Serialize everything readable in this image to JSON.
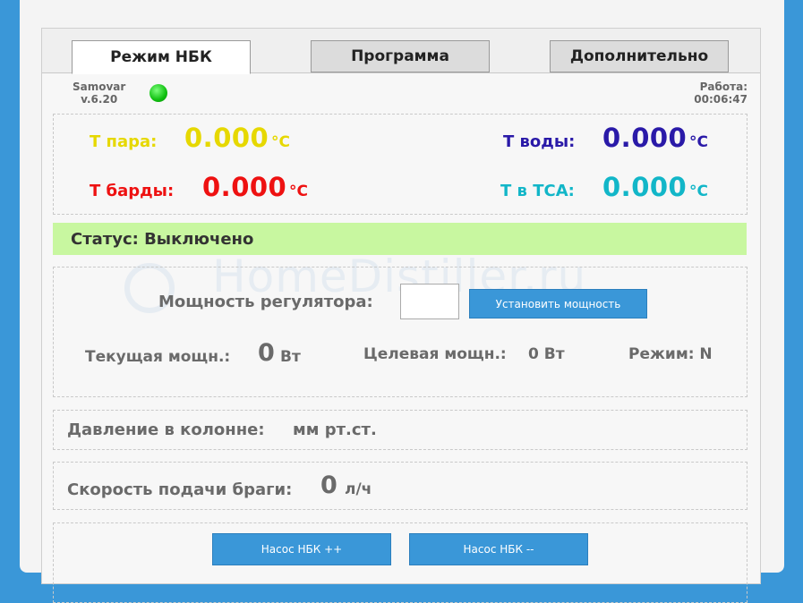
{
  "tabs": [
    {
      "label": "Режим НБК",
      "active": true
    },
    {
      "label": "Программа",
      "active": false
    },
    {
      "label": "Дополнительно",
      "active": false
    }
  ],
  "device": {
    "name": "Samovar",
    "version": "v.6.20",
    "led_color": "#1bc41b"
  },
  "uptime": {
    "label": "Работа:",
    "value": "00:06:47"
  },
  "temperatures": {
    "steam": {
      "label": "Т пара:",
      "value": "0.000",
      "unit": "°C",
      "color": "#e6d800"
    },
    "water": {
      "label": "Т воды:",
      "value": "0.000",
      "unit": "°C",
      "color": "#2a1aa8"
    },
    "bard": {
      "label": "Т барды:",
      "value": "0.000",
      "unit": "°C",
      "color": "#ee1111"
    },
    "tsa": {
      "label": "Т в ТСА:",
      "value": "0.000",
      "unit": "°C",
      "color": "#12b6c8"
    }
  },
  "status": {
    "text": "Статус: Выключено",
    "bg": "#c8f7a0"
  },
  "watermark": "HomeDistiller.ru",
  "power": {
    "regulator_label": "Мощность регулятора:",
    "input_value": "",
    "set_button": "Установить мощность",
    "current_label": "Текущая мощн.:",
    "current_value": "0",
    "current_unit": "Вт",
    "target_label": "Целевая мощн.:",
    "target_value": "0 Вт",
    "mode_label": "Режим: N"
  },
  "pressure": {
    "label": "Давление в колонне:",
    "unit": "мм рт.ст."
  },
  "feed": {
    "label": "Скорость подачи браги:",
    "value": "0",
    "unit": "л/ч"
  },
  "pump": {
    "increase": "Насос НБК ++",
    "decrease": "Насос НБК --"
  },
  "colors": {
    "accent": "#3a97d8"
  }
}
